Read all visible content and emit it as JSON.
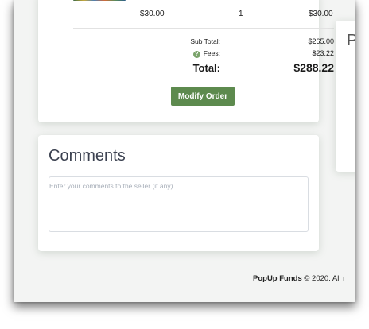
{
  "order": {
    "line_item": {
      "price": "$30.00",
      "quantity": "1",
      "line_total": "$30.00"
    },
    "summary": {
      "subtotal_label": "Sub Total:",
      "subtotal_value": "$265.00",
      "fees_icon": "question-circle-icon",
      "fees_icon_glyph": "?",
      "fees_label": "Fees:",
      "fees_value": "$23.22",
      "total_label": "Total:",
      "total_value": "$288.22"
    },
    "modify_button_label": "Modify Order",
    "accent_color": "#5d8a4e"
  },
  "side_panel": {
    "partial_heading": "P"
  },
  "comments": {
    "title": "Comments",
    "placeholder": "Enter your comments to the seller (if any)",
    "value": ""
  },
  "footer": {
    "brand": "PopUp Funds",
    "copyright": "© 2020. All r"
  }
}
